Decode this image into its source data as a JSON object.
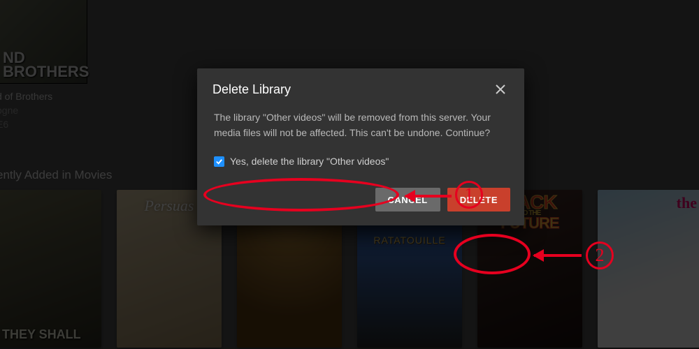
{
  "background": {
    "poster1_title": "ND BROTHERS",
    "meta_title": "d of Brothers",
    "meta_sub": "ogne",
    "meta_ep": "E6",
    "section_heading": "ently Added in Movies",
    "cards": {
      "c1": "THEY SHALL",
      "c2": "Persuas",
      "c4": "RATATOUILLE",
      "c5_back": "BACK",
      "c5_tothe": "TO THE",
      "c5_future": "FUTURE",
      "c6": "the"
    }
  },
  "dialog": {
    "title": "Delete Library",
    "body": "The library \"Other videos\" will be removed from this server. Your media files will not be affected. This can't be undone. Continue?",
    "checkbox_label": "Yes, delete the library \"Other videos\"",
    "checkbox_checked": true,
    "cancel": "CANCEL",
    "delete": "DELETE"
  },
  "annotations": {
    "step1": "1",
    "step2": "2"
  }
}
